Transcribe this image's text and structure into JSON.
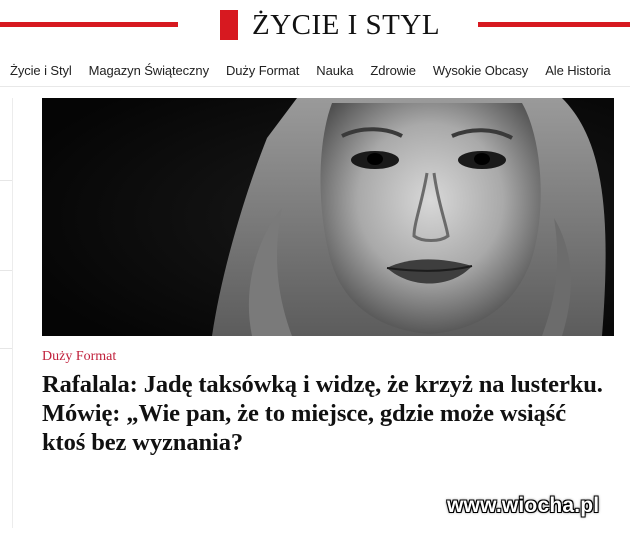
{
  "masthead": {
    "logo_text": "ŻYCIE I STYL",
    "brand_color": "#d71920"
  },
  "nav": {
    "items": [
      {
        "label": "Życie i Styl"
      },
      {
        "label": "Magazyn Świąteczny"
      },
      {
        "label": "Duży Format"
      },
      {
        "label": "Nauka"
      },
      {
        "label": "Zdrowie"
      },
      {
        "label": "Wysokie Obcasy"
      },
      {
        "label": "Ale Historia"
      }
    ]
  },
  "article": {
    "category": "Duży Format",
    "category_color": "#c0203b",
    "headline": "Rafalala: Jadę taksówką i widzę, że krzyż na lusterku. Mówię: „Wie pan, że to miejsce, gdzie może wsiąść ktoś bez wyznania?",
    "image_icon": "portrait-photo"
  },
  "watermark": {
    "text": "www.wiocha.pl"
  }
}
